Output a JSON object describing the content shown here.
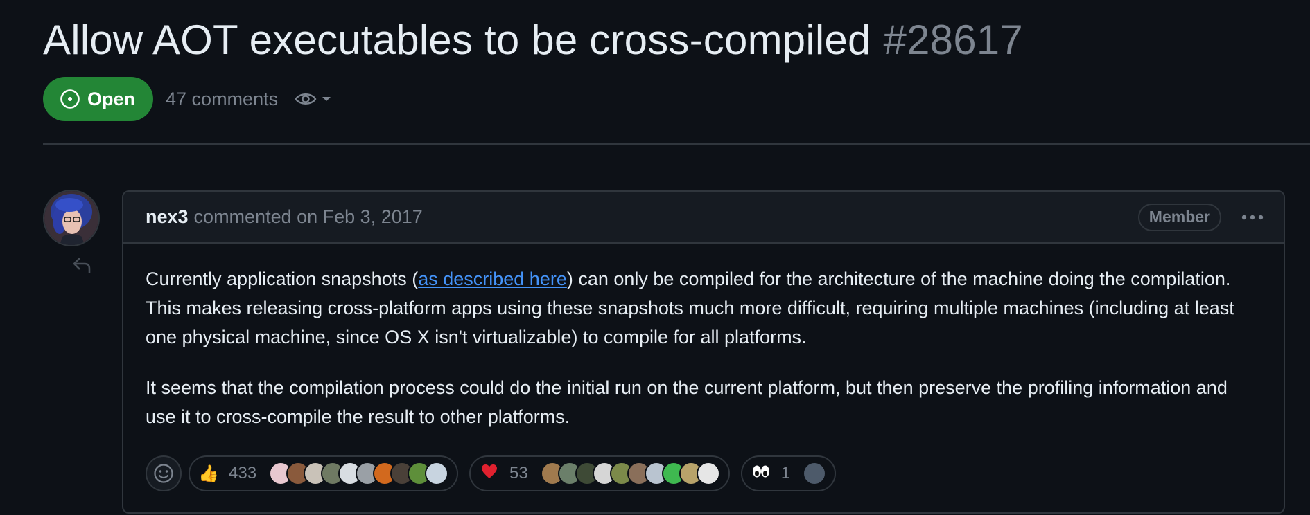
{
  "issue": {
    "title": "Allow AOT executables to be cross-compiled",
    "number": "#28617",
    "state_label": "Open",
    "state_color": "#238636",
    "comments_count": "47 comments",
    "watch_icon": "eye-icon"
  },
  "comment": {
    "author": "nex3",
    "commented_on": "commented on Feb 3, 2017",
    "role_badge": "Member",
    "menu_icon": "kebab-horizontal-icon",
    "paragraph1": {
      "before_link": "Currently application snapshots (",
      "link_text": "as described here",
      "after_link": ") can only be compiled for the architecture of the machine doing the compilation. This makes releasing cross-platform apps using these snapshots much more difficult, requiring multiple machines (including at least one physical machine, since OS X isn't virtualizable) to compile for all platforms."
    },
    "paragraph2": "It seems that the compilation process could do the initial run on the current platform, but then preserve the profiling information and use it to cross-compile the result to other platforms."
  },
  "reactions": {
    "add_icon": "smiley-icon",
    "thumbs_up": {
      "emoji": "👍",
      "count": "433"
    },
    "heart": {
      "emoji": "❤️",
      "count": "53"
    },
    "eyes": {
      "emoji": "👀",
      "count": "1"
    }
  },
  "colors": {
    "background": "#0d1117",
    "link": "#4493f8",
    "muted": "#7d8590",
    "border": "#30363d"
  }
}
